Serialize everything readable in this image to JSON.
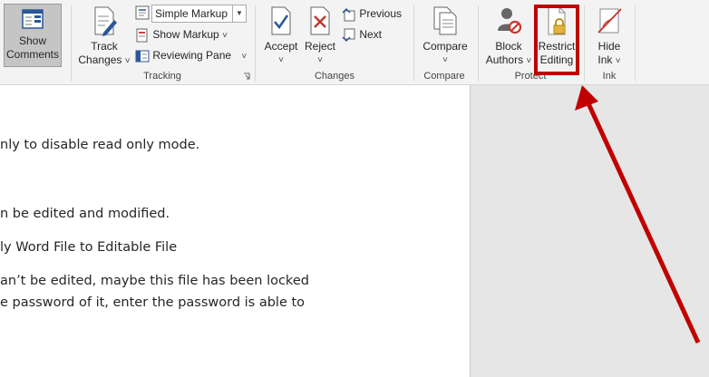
{
  "ribbon": {
    "show_comments": {
      "line1": "Show",
      "line2": "Comments"
    },
    "tracking": {
      "track_changes": {
        "line1": "Track",
        "line2": "Changes"
      },
      "markup_select": "Simple Markup",
      "show_markup": "Show Markup",
      "reviewing_pane": "Reviewing Pane",
      "group_label": "Tracking"
    },
    "changes": {
      "accept": "Accept",
      "reject": "Reject",
      "previous": "Previous",
      "next": "Next",
      "group_label": "Changes"
    },
    "compare": {
      "compare": "Compare",
      "group_label": "Compare"
    },
    "protect": {
      "block_authors": {
        "line1": "Block",
        "line2": "Authors"
      },
      "restrict_editing": {
        "line1": "Restrict",
        "line2": "Editing"
      },
      "group_label": "Protect"
    },
    "ink": {
      "hide_ink": {
        "line1": "Hide",
        "line2": "Ink"
      },
      "group_label": "Ink"
    },
    "chevron": "˅"
  },
  "document": {
    "lines": [
      "nly to disable read only mode.",
      "n be edited and modified.",
      "ly Word File to Editable File",
      "an’t be edited, maybe this file has been locked",
      "e password of it, enter the password is able to"
    ]
  },
  "colors": {
    "highlight": "#c00000",
    "ribbon_bg": "#f3f3f3",
    "side_panel": "#e6e6e6"
  }
}
